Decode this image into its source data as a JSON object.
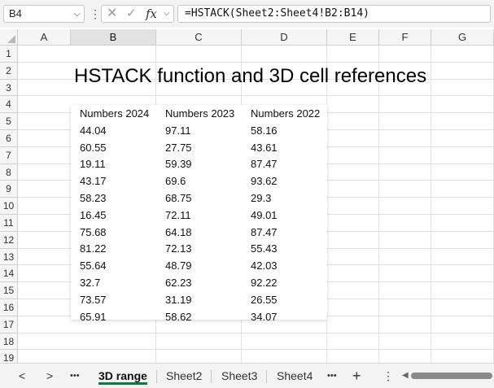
{
  "formula_bar": {
    "name_box": "B4",
    "formula": "=HSTACK(Sheet2:Sheet4!B2:B14)",
    "cancel_icon": "close-icon",
    "enter_icon": "check-icon",
    "fx_label": "fx"
  },
  "columns": [
    "A",
    "B",
    "C",
    "D",
    "E",
    "F",
    "G"
  ],
  "selected_column": "B",
  "rows": [
    "1",
    "2",
    "3",
    "4",
    "5",
    "6",
    "7",
    "8",
    "9",
    "10",
    "11",
    "12",
    "13",
    "14",
    "15",
    "16",
    "17",
    "18",
    "19"
  ],
  "sheet": {
    "title": "HSTACK function and 3D cell references",
    "table": {
      "headers": [
        "Numbers 2024",
        "Numbers 2023",
        "Numbers 2022"
      ],
      "rows": [
        [
          "44.04",
          "97.11",
          "58.16"
        ],
        [
          "60.55",
          "27.75",
          "43.61"
        ],
        [
          "19.11",
          "59.39",
          "87.47"
        ],
        [
          "43.17",
          "69.6",
          "93.62"
        ],
        [
          "58.23",
          "68.75",
          "29.3"
        ],
        [
          "16.45",
          "72.11",
          "49.01"
        ],
        [
          "75.68",
          "64.18",
          "87.47"
        ],
        [
          "81.22",
          "72.13",
          "55.43"
        ],
        [
          "55.64",
          "48.79",
          "42.03"
        ],
        [
          "32.7",
          "62.23",
          "92.22"
        ],
        [
          "73.57",
          "31.19",
          "26.55"
        ],
        [
          "65.91",
          "58.62",
          "34.07"
        ]
      ]
    }
  },
  "tabs": {
    "active": "3D range",
    "items": [
      "3D range",
      "Sheet2",
      "Sheet3",
      "Sheet4"
    ],
    "more": "•••",
    "add": "+",
    "options": "⋮",
    "nav_prev": "<",
    "nav_next": ">"
  },
  "colors": {
    "active_tab_underline": "#1e7145",
    "grid_line": "#e1e1e1",
    "header_bg": "#f5f5f5"
  }
}
